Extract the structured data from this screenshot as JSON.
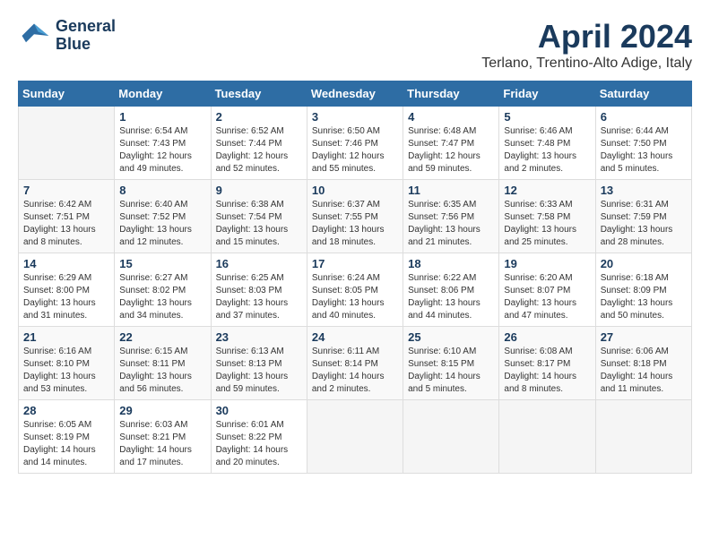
{
  "logo": {
    "line1": "General",
    "line2": "Blue"
  },
  "title": "April 2024",
  "location": "Terlano, Trentino-Alto Adige, Italy",
  "headers": [
    "Sunday",
    "Monday",
    "Tuesday",
    "Wednesday",
    "Thursday",
    "Friday",
    "Saturday"
  ],
  "weeks": [
    [
      {
        "day": "",
        "sunrise": "",
        "sunset": "",
        "daylight": ""
      },
      {
        "day": "1",
        "sunrise": "Sunrise: 6:54 AM",
        "sunset": "Sunset: 7:43 PM",
        "daylight": "Daylight: 12 hours and 49 minutes."
      },
      {
        "day": "2",
        "sunrise": "Sunrise: 6:52 AM",
        "sunset": "Sunset: 7:44 PM",
        "daylight": "Daylight: 12 hours and 52 minutes."
      },
      {
        "day": "3",
        "sunrise": "Sunrise: 6:50 AM",
        "sunset": "Sunset: 7:46 PM",
        "daylight": "Daylight: 12 hours and 55 minutes."
      },
      {
        "day": "4",
        "sunrise": "Sunrise: 6:48 AM",
        "sunset": "Sunset: 7:47 PM",
        "daylight": "Daylight: 12 hours and 59 minutes."
      },
      {
        "day": "5",
        "sunrise": "Sunrise: 6:46 AM",
        "sunset": "Sunset: 7:48 PM",
        "daylight": "Daylight: 13 hours and 2 minutes."
      },
      {
        "day": "6",
        "sunrise": "Sunrise: 6:44 AM",
        "sunset": "Sunset: 7:50 PM",
        "daylight": "Daylight: 13 hours and 5 minutes."
      }
    ],
    [
      {
        "day": "7",
        "sunrise": "Sunrise: 6:42 AM",
        "sunset": "Sunset: 7:51 PM",
        "daylight": "Daylight: 13 hours and 8 minutes."
      },
      {
        "day": "8",
        "sunrise": "Sunrise: 6:40 AM",
        "sunset": "Sunset: 7:52 PM",
        "daylight": "Daylight: 13 hours and 12 minutes."
      },
      {
        "day": "9",
        "sunrise": "Sunrise: 6:38 AM",
        "sunset": "Sunset: 7:54 PM",
        "daylight": "Daylight: 13 hours and 15 minutes."
      },
      {
        "day": "10",
        "sunrise": "Sunrise: 6:37 AM",
        "sunset": "Sunset: 7:55 PM",
        "daylight": "Daylight: 13 hours and 18 minutes."
      },
      {
        "day": "11",
        "sunrise": "Sunrise: 6:35 AM",
        "sunset": "Sunset: 7:56 PM",
        "daylight": "Daylight: 13 hours and 21 minutes."
      },
      {
        "day": "12",
        "sunrise": "Sunrise: 6:33 AM",
        "sunset": "Sunset: 7:58 PM",
        "daylight": "Daylight: 13 hours and 25 minutes."
      },
      {
        "day": "13",
        "sunrise": "Sunrise: 6:31 AM",
        "sunset": "Sunset: 7:59 PM",
        "daylight": "Daylight: 13 hours and 28 minutes."
      }
    ],
    [
      {
        "day": "14",
        "sunrise": "Sunrise: 6:29 AM",
        "sunset": "Sunset: 8:00 PM",
        "daylight": "Daylight: 13 hours and 31 minutes."
      },
      {
        "day": "15",
        "sunrise": "Sunrise: 6:27 AM",
        "sunset": "Sunset: 8:02 PM",
        "daylight": "Daylight: 13 hours and 34 minutes."
      },
      {
        "day": "16",
        "sunrise": "Sunrise: 6:25 AM",
        "sunset": "Sunset: 8:03 PM",
        "daylight": "Daylight: 13 hours and 37 minutes."
      },
      {
        "day": "17",
        "sunrise": "Sunrise: 6:24 AM",
        "sunset": "Sunset: 8:05 PM",
        "daylight": "Daylight: 13 hours and 40 minutes."
      },
      {
        "day": "18",
        "sunrise": "Sunrise: 6:22 AM",
        "sunset": "Sunset: 8:06 PM",
        "daylight": "Daylight: 13 hours and 44 minutes."
      },
      {
        "day": "19",
        "sunrise": "Sunrise: 6:20 AM",
        "sunset": "Sunset: 8:07 PM",
        "daylight": "Daylight: 13 hours and 47 minutes."
      },
      {
        "day": "20",
        "sunrise": "Sunrise: 6:18 AM",
        "sunset": "Sunset: 8:09 PM",
        "daylight": "Daylight: 13 hours and 50 minutes."
      }
    ],
    [
      {
        "day": "21",
        "sunrise": "Sunrise: 6:16 AM",
        "sunset": "Sunset: 8:10 PM",
        "daylight": "Daylight: 13 hours and 53 minutes."
      },
      {
        "day": "22",
        "sunrise": "Sunrise: 6:15 AM",
        "sunset": "Sunset: 8:11 PM",
        "daylight": "Daylight: 13 hours and 56 minutes."
      },
      {
        "day": "23",
        "sunrise": "Sunrise: 6:13 AM",
        "sunset": "Sunset: 8:13 PM",
        "daylight": "Daylight: 13 hours and 59 minutes."
      },
      {
        "day": "24",
        "sunrise": "Sunrise: 6:11 AM",
        "sunset": "Sunset: 8:14 PM",
        "daylight": "Daylight: 14 hours and 2 minutes."
      },
      {
        "day": "25",
        "sunrise": "Sunrise: 6:10 AM",
        "sunset": "Sunset: 8:15 PM",
        "daylight": "Daylight: 14 hours and 5 minutes."
      },
      {
        "day": "26",
        "sunrise": "Sunrise: 6:08 AM",
        "sunset": "Sunset: 8:17 PM",
        "daylight": "Daylight: 14 hours and 8 minutes."
      },
      {
        "day": "27",
        "sunrise": "Sunrise: 6:06 AM",
        "sunset": "Sunset: 8:18 PM",
        "daylight": "Daylight: 14 hours and 11 minutes."
      }
    ],
    [
      {
        "day": "28",
        "sunrise": "Sunrise: 6:05 AM",
        "sunset": "Sunset: 8:19 PM",
        "daylight": "Daylight: 14 hours and 14 minutes."
      },
      {
        "day": "29",
        "sunrise": "Sunrise: 6:03 AM",
        "sunset": "Sunset: 8:21 PM",
        "daylight": "Daylight: 14 hours and 17 minutes."
      },
      {
        "day": "30",
        "sunrise": "Sunrise: 6:01 AM",
        "sunset": "Sunset: 8:22 PM",
        "daylight": "Daylight: 14 hours and 20 minutes."
      },
      {
        "day": "",
        "sunrise": "",
        "sunset": "",
        "daylight": ""
      },
      {
        "day": "",
        "sunrise": "",
        "sunset": "",
        "daylight": ""
      },
      {
        "day": "",
        "sunrise": "",
        "sunset": "",
        "daylight": ""
      },
      {
        "day": "",
        "sunrise": "",
        "sunset": "",
        "daylight": ""
      }
    ]
  ]
}
